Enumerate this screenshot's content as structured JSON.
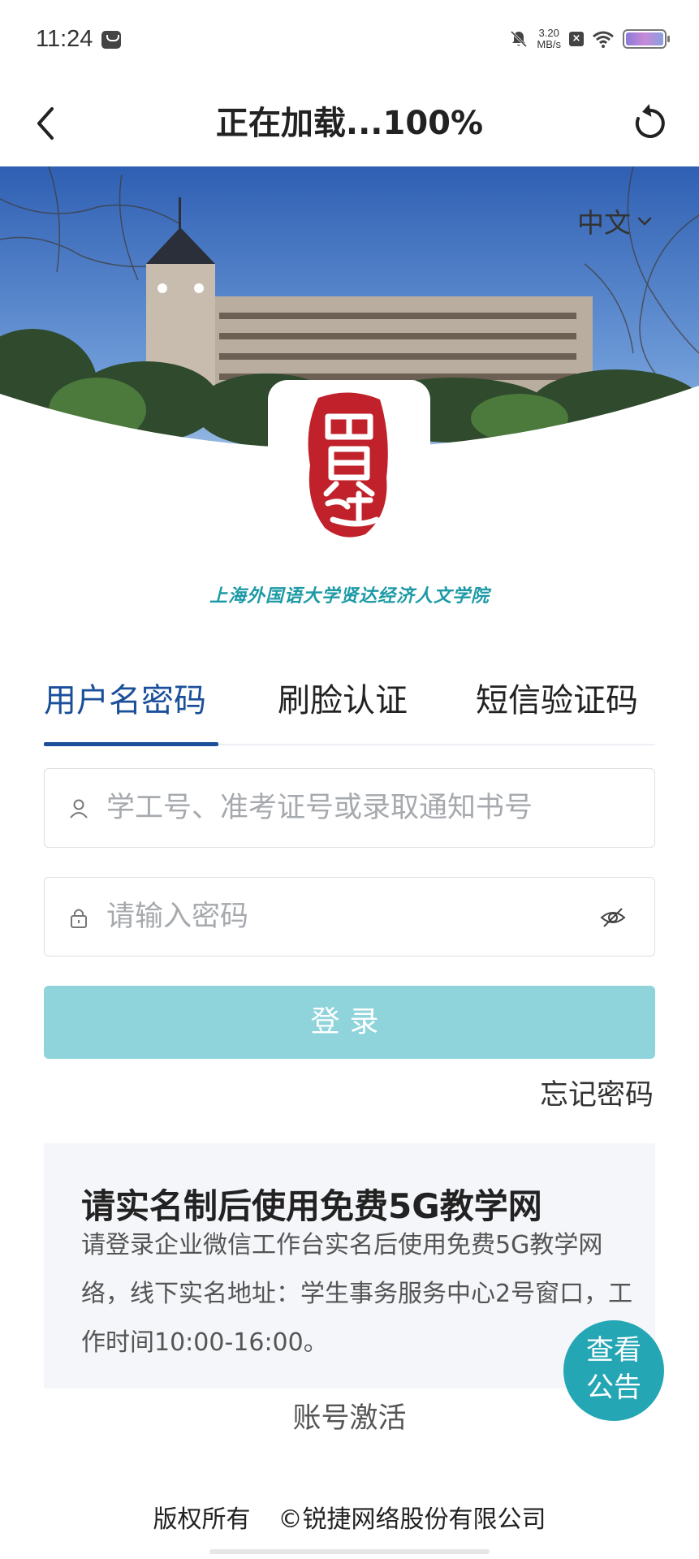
{
  "status_bar": {
    "time": "11:24",
    "speed_value": "3.20",
    "speed_unit": "MB/s",
    "x_badge": "×"
  },
  "nav": {
    "title": "正在加载...100%",
    "back_icon": "chevron-left-icon",
    "refresh_icon": "refresh-icon"
  },
  "banner": {
    "language": "中文"
  },
  "logo": {
    "seal_text": "贸连",
    "school_name": "上海外国语大学贤达经济人文学院"
  },
  "tabs": [
    {
      "label": "用户名密码",
      "active": true
    },
    {
      "label": "刷脸认证",
      "active": false
    },
    {
      "label": "短信验证码",
      "active": false
    }
  ],
  "form": {
    "username_placeholder": "学工号、准考证号或录取通知书号",
    "password_placeholder": "请输入密码",
    "login_label": "登录",
    "forgot_label": "忘记密码"
  },
  "notice": {
    "title": "请实名制后使用免费5G教学网",
    "body": "请登录企业微信工作台实名后使用免费5G教学网络，线下实名地址：学生事务服务中心2号窗口，工作时间10:00-16:00。",
    "button_line1": "查看",
    "button_line2": "公告"
  },
  "activate_label": "账号激活",
  "footer": {
    "copyright": "版权所有",
    "company": "©锐捷网络股份有限公司"
  },
  "colors": {
    "primary": "#1b4f9a",
    "login_button": "#8fd3db",
    "notice_button": "#25a6b4",
    "seal_red": "#c0212a"
  }
}
